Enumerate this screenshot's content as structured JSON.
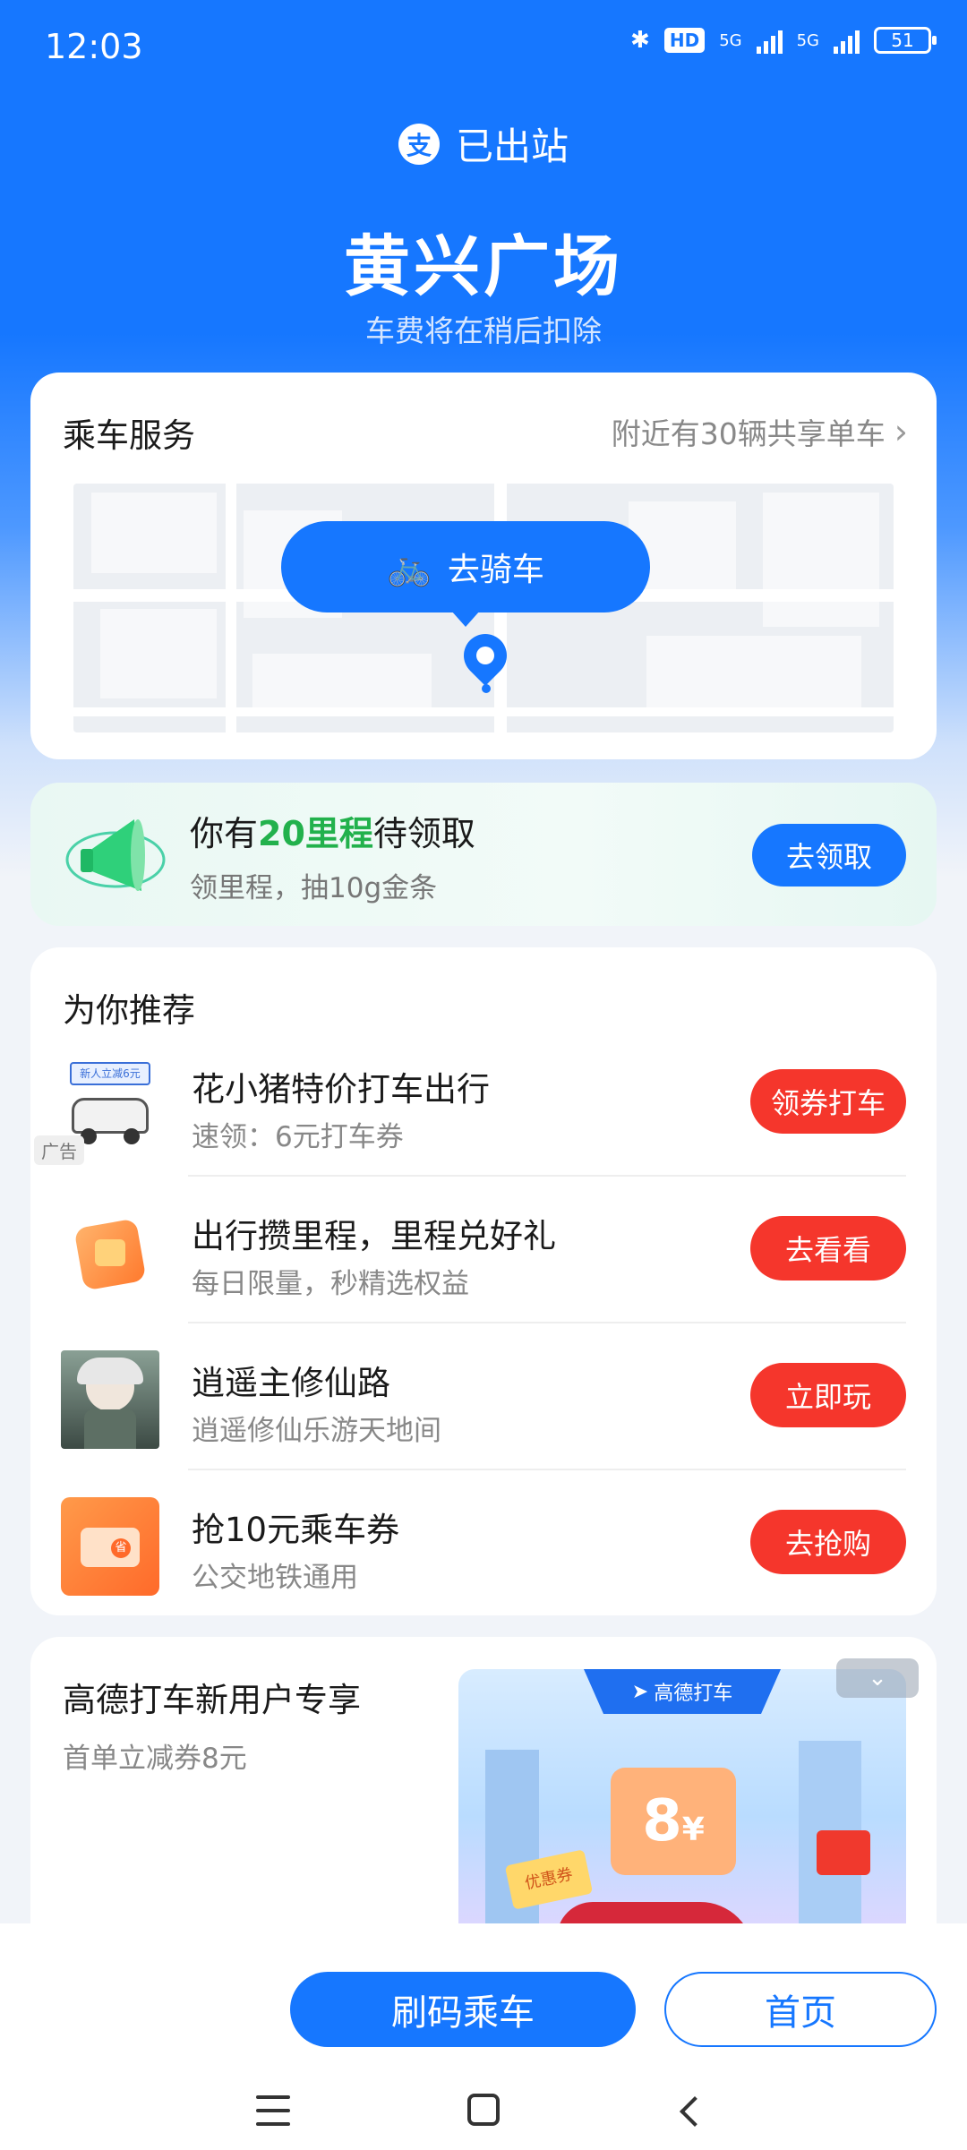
{
  "status_bar": {
    "time": "12:03",
    "hd": "HD",
    "net1": "5G",
    "net2": "5G",
    "battery": "51"
  },
  "header": {
    "status": "已出站",
    "station": "黄兴广场",
    "note": "车费将在稍后扣除"
  },
  "ride_service": {
    "title": "乘车服务",
    "nearby": "附近有30辆共享单车",
    "ride_button": "去骑车"
  },
  "mileage": {
    "title_prefix": "你有",
    "title_highlight": "20里程",
    "title_suffix": "待领取",
    "subtitle": "领里程，抽10g金条",
    "button": "去领取"
  },
  "recommend": {
    "title": "为你推荐",
    "ad_tag": "广告",
    "thumb_text": "新人立减6元",
    "items": [
      {
        "name": "花小猪特价打车出行",
        "sub": "速领：6元打车券",
        "button": "领券打车"
      },
      {
        "name": "出行攒里程，里程兑好礼",
        "sub": "每日限量，秒精选权益",
        "button": "去看看"
      },
      {
        "name": "逍遥主修仙路",
        "sub": "逍遥修仙乐游天地间",
        "button": "立即玩"
      },
      {
        "name": "抢10元乘车券",
        "sub": "公交地铁通用",
        "button": "去抢购"
      }
    ]
  },
  "gaode": {
    "title": "高德打车新用户专享",
    "subtitle": "首单立减券8元",
    "banner": "高德打车",
    "coupon_value": "8",
    "coupon_unit": "¥",
    "coupon_text": "优惠券"
  },
  "bottom": {
    "primary": "刷码乘车",
    "secondary": "首页"
  },
  "colors": {
    "primary": "#1677ff",
    "red": "#f5362c",
    "green": "#22b14c"
  }
}
